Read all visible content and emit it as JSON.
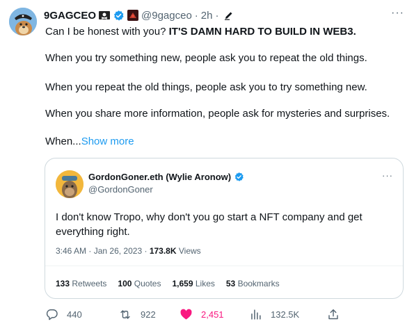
{
  "author": {
    "name": "9GAGCEO",
    "handle": "@9gagceo",
    "time": "2h",
    "separator": "·",
    "icons": [
      "pirate-flag-emoji-icon",
      "verified-badge-icon",
      "affiliate-badge-icon",
      "edit-icon"
    ]
  },
  "tweet": {
    "p1_lead": "Can I be honest with you? ",
    "p1_bold": "IT'S DAMN HARD TO BUILD IN WEB3.",
    "p2": "When you try something new, people ask you to repeat the old things.",
    "p3": "When you repeat the old things, people ask you to try something new.",
    "p4": "When you share more information, people ask for mysteries and surprises.",
    "p5_lead": "When...",
    "show_more": "Show more"
  },
  "more_menu": "···",
  "quoted": {
    "name": "GordonGoner.eth (Wylie Aronow)",
    "handle": "@GordonGoner",
    "more": "···",
    "text": "I don't know Tropo, why don't you go start a NFT company and get everything right.",
    "time": "3:46 AM",
    "date": "Jan 26, 2023",
    "dot": "·",
    "views_count": "173.8K",
    "views_label": "Views",
    "stats": [
      {
        "count": "133",
        "label": "Retweets"
      },
      {
        "count": "100",
        "label": "Quotes"
      },
      {
        "count": "1,659",
        "label": "Likes"
      },
      {
        "count": "53",
        "label": "Bookmarks"
      }
    ]
  },
  "actions": {
    "replies": "440",
    "retweets": "922",
    "likes": "2,451",
    "views": "132.5K"
  },
  "colors": {
    "accent": "#1d9bf0",
    "like": "#f91880",
    "muted": "#536471",
    "border": "#cfd9de"
  }
}
